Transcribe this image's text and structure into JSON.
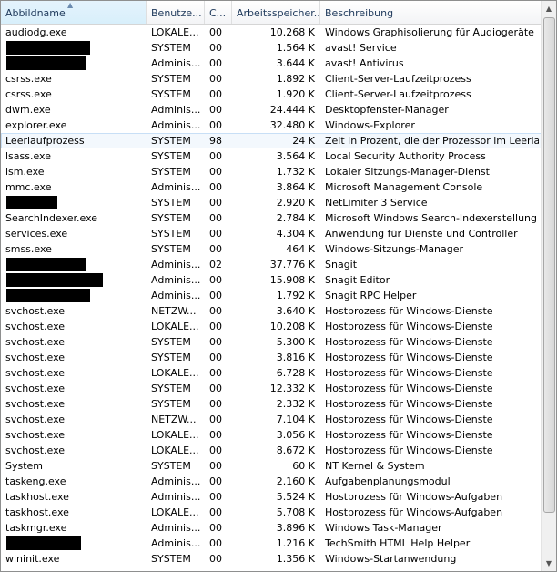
{
  "columns": [
    "Abbildname",
    "Benutze...",
    "C...",
    "Arbeitsspeicher...",
    "Beschreibung"
  ],
  "icons": {
    "sort": "sort-up-icon",
    "scroll_up": "scroll-up-icon",
    "scroll_down": "scroll-down-icon"
  },
  "rows": [
    {
      "name": "audiodg.exe",
      "user": "LOKALE...",
      "cpu": "00",
      "mem": "10.268 K",
      "desc": "Windows Graphisolierung für Audiogeräte"
    },
    {
      "name": "",
      "user": "SYSTEM",
      "cpu": "00",
      "mem": "1.564 K",
      "desc": "avast! Service"
    },
    {
      "name": "",
      "user": "Adminis...",
      "cpu": "00",
      "mem": "3.644 K",
      "desc": "avast! Antivirus"
    },
    {
      "name": "csrss.exe",
      "user": "SYSTEM",
      "cpu": "00",
      "mem": "1.892 K",
      "desc": "Client-Server-Laufzeitprozess"
    },
    {
      "name": "csrss.exe",
      "user": "SYSTEM",
      "cpu": "00",
      "mem": "1.920 K",
      "desc": "Client-Server-Laufzeitprozess"
    },
    {
      "name": "dwm.exe",
      "user": "Adminis...",
      "cpu": "00",
      "mem": "24.444 K",
      "desc": "Desktopfenster-Manager"
    },
    {
      "name": "explorer.exe",
      "user": "Adminis...",
      "cpu": "00",
      "mem": "32.480 K",
      "desc": "Windows-Explorer"
    },
    {
      "name": "Leerlaufprozess",
      "user": "SYSTEM",
      "cpu": "98",
      "mem": "24 K",
      "desc": "Zeit in Prozent, die der Prozessor im Leerla...",
      "selected": true
    },
    {
      "name": "lsass.exe",
      "user": "SYSTEM",
      "cpu": "00",
      "mem": "3.564 K",
      "desc": "Local Security Authority Process"
    },
    {
      "name": "lsm.exe",
      "user": "SYSTEM",
      "cpu": "00",
      "mem": "1.732 K",
      "desc": "Lokaler Sitzungs-Manager-Dienst"
    },
    {
      "name": "mmc.exe",
      "user": "Adminis...",
      "cpu": "00",
      "mem": "3.864 K",
      "desc": "Microsoft Management Console"
    },
    {
      "name": "",
      "user": "SYSTEM",
      "cpu": "00",
      "mem": "2.920 K",
      "desc": "NetLimiter 3 Service"
    },
    {
      "name": "SearchIndexer.exe",
      "user": "SYSTEM",
      "cpu": "00",
      "mem": "2.784 K",
      "desc": "Microsoft Windows Search-Indexerstellung"
    },
    {
      "name": "services.exe",
      "user": "SYSTEM",
      "cpu": "00",
      "mem": "4.304 K",
      "desc": "Anwendung für Dienste und Controller"
    },
    {
      "name": "smss.exe",
      "user": "SYSTEM",
      "cpu": "00",
      "mem": "464 K",
      "desc": "Windows-Sitzungs-Manager"
    },
    {
      "name": "",
      "user": "Adminis...",
      "cpu": "02",
      "mem": "37.776 K",
      "desc": "Snagit"
    },
    {
      "name": "",
      "user": "Adminis...",
      "cpu": "00",
      "mem": "15.908 K",
      "desc": "Snagit Editor"
    },
    {
      "name": "",
      "user": "Adminis...",
      "cpu": "00",
      "mem": "1.792 K",
      "desc": "Snagit RPC Helper"
    },
    {
      "name": "svchost.exe",
      "user": "NETZW...",
      "cpu": "00",
      "mem": "3.640 K",
      "desc": "Hostprozess für Windows-Dienste"
    },
    {
      "name": "svchost.exe",
      "user": "LOKALE...",
      "cpu": "00",
      "mem": "10.208 K",
      "desc": "Hostprozess für Windows-Dienste"
    },
    {
      "name": "svchost.exe",
      "user": "SYSTEM",
      "cpu": "00",
      "mem": "5.300 K",
      "desc": "Hostprozess für Windows-Dienste"
    },
    {
      "name": "svchost.exe",
      "user": "SYSTEM",
      "cpu": "00",
      "mem": "3.816 K",
      "desc": "Hostprozess für Windows-Dienste"
    },
    {
      "name": "svchost.exe",
      "user": "LOKALE...",
      "cpu": "00",
      "mem": "6.728 K",
      "desc": "Hostprozess für Windows-Dienste"
    },
    {
      "name": "svchost.exe",
      "user": "SYSTEM",
      "cpu": "00",
      "mem": "12.332 K",
      "desc": "Hostprozess für Windows-Dienste"
    },
    {
      "name": "svchost.exe",
      "user": "SYSTEM",
      "cpu": "00",
      "mem": "2.332 K",
      "desc": "Hostprozess für Windows-Dienste"
    },
    {
      "name": "svchost.exe",
      "user": "NETZW...",
      "cpu": "00",
      "mem": "7.104 K",
      "desc": "Hostprozess für Windows-Dienste"
    },
    {
      "name": "svchost.exe",
      "user": "LOKALE...",
      "cpu": "00",
      "mem": "3.056 K",
      "desc": "Hostprozess für Windows-Dienste"
    },
    {
      "name": "svchost.exe",
      "user": "LOKALE...",
      "cpu": "00",
      "mem": "8.672 K",
      "desc": "Hostprozess für Windows-Dienste"
    },
    {
      "name": "System",
      "user": "SYSTEM",
      "cpu": "00",
      "mem": "60 K",
      "desc": "NT Kernel & System"
    },
    {
      "name": "taskeng.exe",
      "user": "Adminis...",
      "cpu": "00",
      "mem": "2.160 K",
      "desc": "Aufgabenplanungsmodul"
    },
    {
      "name": "taskhost.exe",
      "user": "Adminis...",
      "cpu": "00",
      "mem": "5.524 K",
      "desc": "Hostprozess für Windows-Aufgaben"
    },
    {
      "name": "taskhost.exe",
      "user": "LOKALE...",
      "cpu": "00",
      "mem": "5.708 K",
      "desc": "Hostprozess für Windows-Aufgaben"
    },
    {
      "name": "taskmgr.exe",
      "user": "Adminis...",
      "cpu": "00",
      "mem": "3.896 K",
      "desc": "Windows Task-Manager"
    },
    {
      "name": "",
      "user": "Adminis...",
      "cpu": "00",
      "mem": "1.216 K",
      "desc": "TechSmith HTML Help Helper"
    },
    {
      "name": "wininit.exe",
      "user": "SYSTEM",
      "cpu": "00",
      "mem": "1.356 K",
      "desc": "Windows-Startanwendung"
    }
  ]
}
